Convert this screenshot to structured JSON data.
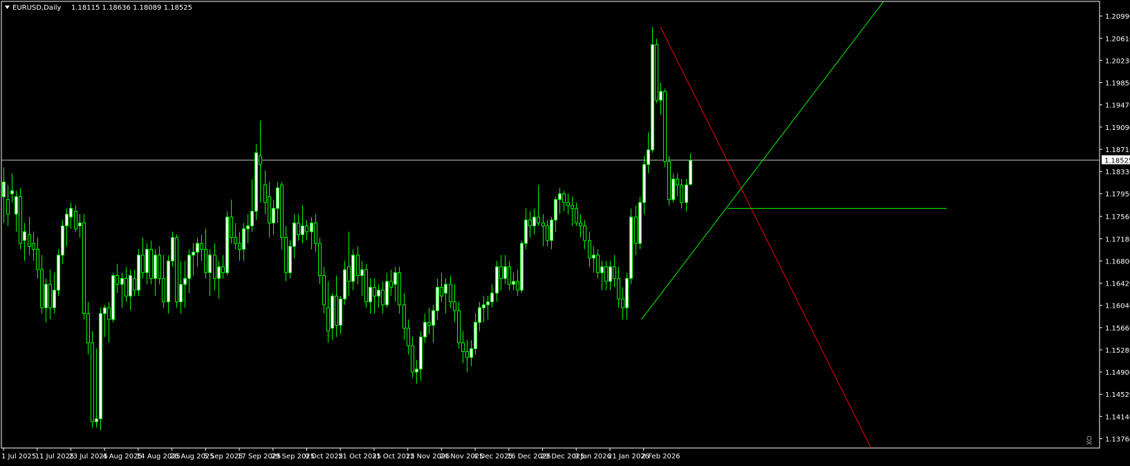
{
  "header": {
    "symbol": "EURUSD,Daily",
    "ohlc": "1.18115 1.18636 1.18089 1.18525"
  },
  "colors": {
    "background": "#000000",
    "bull_candle": "#ffffff",
    "bear_candle": "#000000",
    "wick": "#00ff00",
    "bid_line": "#c0c0c0",
    "trendline_green": "#00ff00",
    "trendline_red": "#ff0000",
    "axis_text": "#ffffff"
  },
  "icons": {
    "corner_marker": "skull-icon"
  },
  "chart_data": {
    "type": "candlestick",
    "symbol": "EURUSD",
    "timeframe": "Daily",
    "current_price": 1.18525,
    "current_price_label": "1.18525",
    "y_range": [
      1.136,
      1.2124
    ],
    "y_ticks": [
      "1.20990",
      "1.20610",
      "1.20230",
      "1.19850",
      "1.19470",
      "1.19090",
      "1.18710",
      "1.18330",
      "1.17950",
      "1.17560",
      "1.17180",
      "1.16800",
      "1.16420",
      "1.16040",
      "1.15660",
      "1.15280",
      "1.14900",
      "1.14520",
      "1.14140",
      "1.13760"
    ],
    "x_labels": [
      {
        "label": "1 Jul 2025",
        "index": 0
      },
      {
        "label": "11 Jul 2025",
        "index": 8
      },
      {
        "label": "23 Jul 2025",
        "index": 16
      },
      {
        "label": "4 Aug 2025",
        "index": 24
      },
      {
        "label": "14 Aug 2025",
        "index": 32
      },
      {
        "label": "26 Aug 2025",
        "index": 40
      },
      {
        "label": "5 Sep 2025",
        "index": 48
      },
      {
        "label": "17 Sep 2025",
        "index": 56
      },
      {
        "label": "29 Sep 2025",
        "index": 64
      },
      {
        "label": "9 Oct 2025",
        "index": 72
      },
      {
        "label": "21 Oct 2025",
        "index": 80
      },
      {
        "label": "31 Oct 2025",
        "index": 88
      },
      {
        "label": "12 Nov 2025",
        "index": 96
      },
      {
        "label": "24 Nov 2025",
        "index": 104
      },
      {
        "label": "4 Dec 2025",
        "index": 112
      },
      {
        "label": "16 Dec 2025",
        "index": 120
      },
      {
        "label": "29 Dec 2025",
        "index": 128
      },
      {
        "label": "9 Jan 2026",
        "index": 136
      },
      {
        "label": "21 Jan 2026",
        "index": 144
      },
      {
        "label": "2 Feb 2026",
        "index": 152
      }
    ],
    "candles": [
      {
        "o": 1.179,
        "h": 1.184,
        "l": 1.1745,
        "c": 1.1815
      },
      {
        "o": 1.1785,
        "h": 1.181,
        "l": 1.174,
        "c": 1.176
      },
      {
        "o": 1.1795,
        "h": 1.183,
        "l": 1.178,
        "c": 1.18
      },
      {
        "o": 1.176,
        "h": 1.18,
        "l": 1.173,
        "c": 1.179
      },
      {
        "o": 1.179,
        "h": 1.1805,
        "l": 1.17,
        "c": 1.171
      },
      {
        "o": 1.1715,
        "h": 1.1745,
        "l": 1.168,
        "c": 1.173
      },
      {
        "o": 1.1725,
        "h": 1.1755,
        "l": 1.169,
        "c": 1.1705
      },
      {
        "o": 1.171,
        "h": 1.173,
        "l": 1.168,
        "c": 1.17
      },
      {
        "o": 1.17,
        "h": 1.172,
        "l": 1.165,
        "c": 1.1665
      },
      {
        "o": 1.1665,
        "h": 1.169,
        "l": 1.159,
        "c": 1.16
      },
      {
        "o": 1.16,
        "h": 1.165,
        "l": 1.1575,
        "c": 1.164
      },
      {
        "o": 1.164,
        "h": 1.1665,
        "l": 1.158,
        "c": 1.16
      },
      {
        "o": 1.16,
        "h": 1.166,
        "l": 1.159,
        "c": 1.163
      },
      {
        "o": 1.163,
        "h": 1.17,
        "l": 1.162,
        "c": 1.169
      },
      {
        "o": 1.169,
        "h": 1.175,
        "l": 1.1675,
        "c": 1.174
      },
      {
        "o": 1.174,
        "h": 1.177,
        "l": 1.1705,
        "c": 1.176
      },
      {
        "o": 1.1755,
        "h": 1.178,
        "l": 1.1735,
        "c": 1.177
      },
      {
        "o": 1.1765,
        "h": 1.1775,
        "l": 1.173,
        "c": 1.1735
      },
      {
        "o": 1.174,
        "h": 1.176,
        "l": 1.172,
        "c": 1.1745
      },
      {
        "o": 1.1745,
        "h": 1.176,
        "l": 1.158,
        "c": 1.159
      },
      {
        "o": 1.159,
        "h": 1.161,
        "l": 1.152,
        "c": 1.154
      },
      {
        "o": 1.154,
        "h": 1.156,
        "l": 1.1395,
        "c": 1.1405
      },
      {
        "o": 1.1405,
        "h": 1.153,
        "l": 1.1395,
        "c": 1.141
      },
      {
        "o": 1.141,
        "h": 1.16,
        "l": 1.139,
        "c": 1.159
      },
      {
        "o": 1.159,
        "h": 1.1605,
        "l": 1.155,
        "c": 1.16
      },
      {
        "o": 1.16,
        "h": 1.161,
        "l": 1.154,
        "c": 1.158
      },
      {
        "o": 1.158,
        "h": 1.166,
        "l": 1.1575,
        "c": 1.1655
      },
      {
        "o": 1.1655,
        "h": 1.1675,
        "l": 1.1625,
        "c": 1.164
      },
      {
        "o": 1.164,
        "h": 1.166,
        "l": 1.16,
        "c": 1.165
      },
      {
        "o": 1.165,
        "h": 1.167,
        "l": 1.161,
        "c": 1.162
      },
      {
        "o": 1.162,
        "h": 1.1665,
        "l": 1.1595,
        "c": 1.1655
      },
      {
        "o": 1.165,
        "h": 1.1665,
        "l": 1.162,
        "c": 1.163
      },
      {
        "o": 1.163,
        "h": 1.17,
        "l": 1.162,
        "c": 1.169
      },
      {
        "o": 1.169,
        "h": 1.172,
        "l": 1.165,
        "c": 1.166
      },
      {
        "o": 1.166,
        "h": 1.171,
        "l": 1.164,
        "c": 1.17
      },
      {
        "o": 1.17,
        "h": 1.1715,
        "l": 1.164,
        "c": 1.165
      },
      {
        "o": 1.165,
        "h": 1.17,
        "l": 1.162,
        "c": 1.169
      },
      {
        "o": 1.169,
        "h": 1.1705,
        "l": 1.164,
        "c": 1.165
      },
      {
        "o": 1.165,
        "h": 1.169,
        "l": 1.16,
        "c": 1.161
      },
      {
        "o": 1.161,
        "h": 1.169,
        "l": 1.159,
        "c": 1.168
      },
      {
        "o": 1.168,
        "h": 1.173,
        "l": 1.167,
        "c": 1.172
      },
      {
        "o": 1.172,
        "h": 1.1725,
        "l": 1.16,
        "c": 1.161
      },
      {
        "o": 1.161,
        "h": 1.168,
        "l": 1.159,
        "c": 1.164
      },
      {
        "o": 1.164,
        "h": 1.168,
        "l": 1.16,
        "c": 1.165
      },
      {
        "o": 1.165,
        "h": 1.17,
        "l": 1.1625,
        "c": 1.169
      },
      {
        "o": 1.169,
        "h": 1.171,
        "l": 1.1655,
        "c": 1.1695
      },
      {
        "o": 1.1695,
        "h": 1.172,
        "l": 1.167,
        "c": 1.171
      },
      {
        "o": 1.171,
        "h": 1.1725,
        "l": 1.168,
        "c": 1.17
      },
      {
        "o": 1.17,
        "h": 1.1735,
        "l": 1.165,
        "c": 1.166
      },
      {
        "o": 1.166,
        "h": 1.17,
        "l": 1.162,
        "c": 1.169
      },
      {
        "o": 1.169,
        "h": 1.171,
        "l": 1.163,
        "c": 1.165
      },
      {
        "o": 1.165,
        "h": 1.168,
        "l": 1.1615,
        "c": 1.167
      },
      {
        "o": 1.167,
        "h": 1.169,
        "l": 1.165,
        "c": 1.166
      },
      {
        "o": 1.166,
        "h": 1.1765,
        "l": 1.1655,
        "c": 1.1755
      },
      {
        "o": 1.1755,
        "h": 1.1785,
        "l": 1.171,
        "c": 1.172
      },
      {
        "o": 1.172,
        "h": 1.1745,
        "l": 1.17,
        "c": 1.171
      },
      {
        "o": 1.171,
        "h": 1.173,
        "l": 1.168,
        "c": 1.17
      },
      {
        "o": 1.17,
        "h": 1.1745,
        "l": 1.168,
        "c": 1.1735
      },
      {
        "o": 1.1735,
        "h": 1.176,
        "l": 1.171,
        "c": 1.174
      },
      {
        "o": 1.174,
        "h": 1.182,
        "l": 1.173,
        "c": 1.1765
      },
      {
        "o": 1.1765,
        "h": 1.188,
        "l": 1.175,
        "c": 1.1865
      },
      {
        "o": 1.186,
        "h": 1.192,
        "l": 1.178,
        "c": 1.1845
      },
      {
        "o": 1.181,
        "h": 1.1835,
        "l": 1.176,
        "c": 1.178
      },
      {
        "o": 1.179,
        "h": 1.1815,
        "l": 1.172,
        "c": 1.1745
      },
      {
        "o": 1.1745,
        "h": 1.1785,
        "l": 1.1725,
        "c": 1.177
      },
      {
        "o": 1.177,
        "h": 1.1815,
        "l": 1.1745,
        "c": 1.1805
      },
      {
        "o": 1.181,
        "h": 1.1815,
        "l": 1.17,
        "c": 1.172
      },
      {
        "o": 1.172,
        "h": 1.174,
        "l": 1.1645,
        "c": 1.166
      },
      {
        "o": 1.166,
        "h": 1.1715,
        "l": 1.165,
        "c": 1.1705
      },
      {
        "o": 1.1705,
        "h": 1.176,
        "l": 1.1685,
        "c": 1.1745
      },
      {
        "o": 1.1745,
        "h": 1.176,
        "l": 1.1715,
        "c": 1.1725
      },
      {
        "o": 1.1725,
        "h": 1.1775,
        "l": 1.171,
        "c": 1.174
      },
      {
        "o": 1.174,
        "h": 1.175,
        "l": 1.1715,
        "c": 1.173
      },
      {
        "o": 1.173,
        "h": 1.1755,
        "l": 1.17,
        "c": 1.1745
      },
      {
        "o": 1.1745,
        "h": 1.176,
        "l": 1.1695,
        "c": 1.171
      },
      {
        "o": 1.171,
        "h": 1.172,
        "l": 1.164,
        "c": 1.1655
      },
      {
        "o": 1.1655,
        "h": 1.167,
        "l": 1.159,
        "c": 1.1605
      },
      {
        "o": 1.16,
        "h": 1.1645,
        "l": 1.154,
        "c": 1.156
      },
      {
        "o": 1.1565,
        "h": 1.1625,
        "l": 1.1545,
        "c": 1.162
      },
      {
        "o": 1.162,
        "h": 1.1655,
        "l": 1.155,
        "c": 1.157
      },
      {
        "o": 1.157,
        "h": 1.162,
        "l": 1.1555,
        "c": 1.1615
      },
      {
        "o": 1.1615,
        "h": 1.168,
        "l": 1.1605,
        "c": 1.1665
      },
      {
        "o": 1.167,
        "h": 1.173,
        "l": 1.162,
        "c": 1.1645
      },
      {
        "o": 1.1645,
        "h": 1.17,
        "l": 1.163,
        "c": 1.169
      },
      {
        "o": 1.169,
        "h": 1.1705,
        "l": 1.164,
        "c": 1.1655
      },
      {
        "o": 1.1655,
        "h": 1.168,
        "l": 1.162,
        "c": 1.1665
      },
      {
        "o": 1.1665,
        "h": 1.1675,
        "l": 1.16,
        "c": 1.161
      },
      {
        "o": 1.161,
        "h": 1.165,
        "l": 1.159,
        "c": 1.1635
      },
      {
        "o": 1.1635,
        "h": 1.165,
        "l": 1.159,
        "c": 1.162
      },
      {
        "o": 1.162,
        "h": 1.164,
        "l": 1.16,
        "c": 1.163
      },
      {
        "o": 1.163,
        "h": 1.1645,
        "l": 1.159,
        "c": 1.1605
      },
      {
        "o": 1.1605,
        "h": 1.166,
        "l": 1.16,
        "c": 1.1645
      },
      {
        "o": 1.1645,
        "h": 1.1665,
        "l": 1.162,
        "c": 1.1635
      },
      {
        "o": 1.164,
        "h": 1.167,
        "l": 1.161,
        "c": 1.166
      },
      {
        "o": 1.166,
        "h": 1.167,
        "l": 1.159,
        "c": 1.1605
      },
      {
        "o": 1.1605,
        "h": 1.1625,
        "l": 1.1545,
        "c": 1.1565
      },
      {
        "o": 1.1565,
        "h": 1.158,
        "l": 1.152,
        "c": 1.1535
      },
      {
        "o": 1.1535,
        "h": 1.155,
        "l": 1.148,
        "c": 1.149
      },
      {
        "o": 1.149,
        "h": 1.151,
        "l": 1.147,
        "c": 1.1495
      },
      {
        "o": 1.1495,
        "h": 1.156,
        "l": 1.1475,
        "c": 1.155
      },
      {
        "o": 1.155,
        "h": 1.159,
        "l": 1.154,
        "c": 1.1575
      },
      {
        "o": 1.1575,
        "h": 1.16,
        "l": 1.1555,
        "c": 1.157
      },
      {
        "o": 1.157,
        "h": 1.1605,
        "l": 1.154,
        "c": 1.1595
      },
      {
        "o": 1.1595,
        "h": 1.165,
        "l": 1.158,
        "c": 1.1635
      },
      {
        "o": 1.1635,
        "h": 1.166,
        "l": 1.161,
        "c": 1.162
      },
      {
        "o": 1.1625,
        "h": 1.165,
        "l": 1.159,
        "c": 1.164
      },
      {
        "o": 1.164,
        "h": 1.1655,
        "l": 1.16,
        "c": 1.161
      },
      {
        "o": 1.161,
        "h": 1.164,
        "l": 1.1575,
        "c": 1.1595
      },
      {
        "o": 1.1595,
        "h": 1.161,
        "l": 1.153,
        "c": 1.154
      },
      {
        "o": 1.154,
        "h": 1.156,
        "l": 1.1505,
        "c": 1.1525
      },
      {
        "o": 1.1525,
        "h": 1.1545,
        "l": 1.149,
        "c": 1.1515
      },
      {
        "o": 1.1515,
        "h": 1.1545,
        "l": 1.15,
        "c": 1.153
      },
      {
        "o": 1.153,
        "h": 1.159,
        "l": 1.152,
        "c": 1.1575
      },
      {
        "o": 1.1575,
        "h": 1.161,
        "l": 1.156,
        "c": 1.16
      },
      {
        "o": 1.16,
        "h": 1.162,
        "l": 1.1575,
        "c": 1.1605
      },
      {
        "o": 1.1605,
        "h": 1.162,
        "l": 1.158,
        "c": 1.161
      },
      {
        "o": 1.161,
        "h": 1.164,
        "l": 1.16,
        "c": 1.1625
      },
      {
        "o": 1.1625,
        "h": 1.168,
        "l": 1.161,
        "c": 1.167
      },
      {
        "o": 1.167,
        "h": 1.169,
        "l": 1.163,
        "c": 1.165
      },
      {
        "o": 1.165,
        "h": 1.169,
        "l": 1.164,
        "c": 1.167
      },
      {
        "o": 1.167,
        "h": 1.168,
        "l": 1.163,
        "c": 1.164
      },
      {
        "o": 1.164,
        "h": 1.166,
        "l": 1.163,
        "c": 1.1645
      },
      {
        "o": 1.1645,
        "h": 1.1665,
        "l": 1.162,
        "c": 1.163
      },
      {
        "o": 1.163,
        "h": 1.1715,
        "l": 1.1625,
        "c": 1.171
      },
      {
        "o": 1.171,
        "h": 1.177,
        "l": 1.17,
        "c": 1.175
      },
      {
        "o": 1.175,
        "h": 1.1765,
        "l": 1.172,
        "c": 1.174
      },
      {
        "o": 1.174,
        "h": 1.177,
        "l": 1.1725,
        "c": 1.1755
      },
      {
        "o": 1.1755,
        "h": 1.181,
        "l": 1.174,
        "c": 1.1745
      },
      {
        "o": 1.1745,
        "h": 1.176,
        "l": 1.1705,
        "c": 1.174
      },
      {
        "o": 1.174,
        "h": 1.175,
        "l": 1.1705,
        "c": 1.1715
      },
      {
        "o": 1.1715,
        "h": 1.1755,
        "l": 1.17,
        "c": 1.175
      },
      {
        "o": 1.175,
        "h": 1.179,
        "l": 1.173,
        "c": 1.1785
      },
      {
        "o": 1.1785,
        "h": 1.1805,
        "l": 1.176,
        "c": 1.1795
      },
      {
        "o": 1.1795,
        "h": 1.18,
        "l": 1.1765,
        "c": 1.178
      },
      {
        "o": 1.178,
        "h": 1.1795,
        "l": 1.176,
        "c": 1.1775
      },
      {
        "o": 1.1775,
        "h": 1.179,
        "l": 1.174,
        "c": 1.177
      },
      {
        "o": 1.177,
        "h": 1.178,
        "l": 1.174,
        "c": 1.1745
      },
      {
        "o": 1.1745,
        "h": 1.176,
        "l": 1.172,
        "c": 1.174
      },
      {
        "o": 1.174,
        "h": 1.175,
        "l": 1.17,
        "c": 1.1715
      },
      {
        "o": 1.1715,
        "h": 1.173,
        "l": 1.167,
        "c": 1.1685
      },
      {
        "o": 1.1685,
        "h": 1.1705,
        "l": 1.166,
        "c": 1.169
      },
      {
        "o": 1.169,
        "h": 1.17,
        "l": 1.165,
        "c": 1.166
      },
      {
        "o": 1.166,
        "h": 1.168,
        "l": 1.163,
        "c": 1.167
      },
      {
        "o": 1.167,
        "h": 1.168,
        "l": 1.163,
        "c": 1.1645
      },
      {
        "o": 1.1645,
        "h": 1.168,
        "l": 1.163,
        "c": 1.167
      },
      {
        "o": 1.167,
        "h": 1.169,
        "l": 1.1635,
        "c": 1.165
      },
      {
        "o": 1.165,
        "h": 1.167,
        "l": 1.16,
        "c": 1.1615
      },
      {
        "o": 1.1615,
        "h": 1.1635,
        "l": 1.158,
        "c": 1.16
      },
      {
        "o": 1.16,
        "h": 1.166,
        "l": 1.158,
        "c": 1.165
      },
      {
        "o": 1.165,
        "h": 1.177,
        "l": 1.164,
        "c": 1.1755
      },
      {
        "o": 1.1755,
        "h": 1.1775,
        "l": 1.169,
        "c": 1.171
      },
      {
        "o": 1.171,
        "h": 1.179,
        "l": 1.17,
        "c": 1.178
      },
      {
        "o": 1.178,
        "h": 1.186,
        "l": 1.176,
        "c": 1.1845
      },
      {
        "o": 1.1845,
        "h": 1.19,
        "l": 1.183,
        "c": 1.187
      },
      {
        "o": 1.187,
        "h": 1.208,
        "l": 1.1865,
        "c": 1.205
      },
      {
        "o": 1.205,
        "h": 1.206,
        "l": 1.195,
        "c": 1.1955
      },
      {
        "o": 1.1955,
        "h": 1.1985,
        "l": 1.193,
        "c": 1.197
      },
      {
        "o": 1.197,
        "h": 1.1975,
        "l": 1.184,
        "c": 1.185
      },
      {
        "o": 1.185,
        "h": 1.186,
        "l": 1.1775,
        "c": 1.1785
      },
      {
        "o": 1.1785,
        "h": 1.183,
        "l": 1.178,
        "c": 1.182
      },
      {
        "o": 1.182,
        "h": 1.183,
        "l": 1.179,
        "c": 1.181
      },
      {
        "o": 1.181,
        "h": 1.182,
        "l": 1.177,
        "c": 1.178
      },
      {
        "o": 1.178,
        "h": 1.182,
        "l": 1.1765,
        "c": 1.181
      },
      {
        "o": 1.1811,
        "h": 1.1864,
        "l": 1.1809,
        "c": 1.1852
      }
    ],
    "trendlines": [
      {
        "name": "green-support",
        "color": "#00ff00",
        "from": {
          "index": 151.5,
          "price": 1.158
        },
        "to": {
          "index": 172,
          "price": 1.177
        },
        "extends_to": {
          "index": 209,
          "price": 1.2124
        }
      },
      {
        "name": "red-resistance",
        "color": "#ff0000",
        "from": {
          "index": 156,
          "price": 1.208
        },
        "to": {
          "index": 206,
          "price": 1.136
        }
      },
      {
        "name": "green-horizontal",
        "color": "#00ff00",
        "from": {
          "index": 172,
          "price": 1.177
        },
        "to": {
          "index": 224,
          "price": 1.177
        }
      }
    ],
    "bid_line_price": 1.18525
  }
}
